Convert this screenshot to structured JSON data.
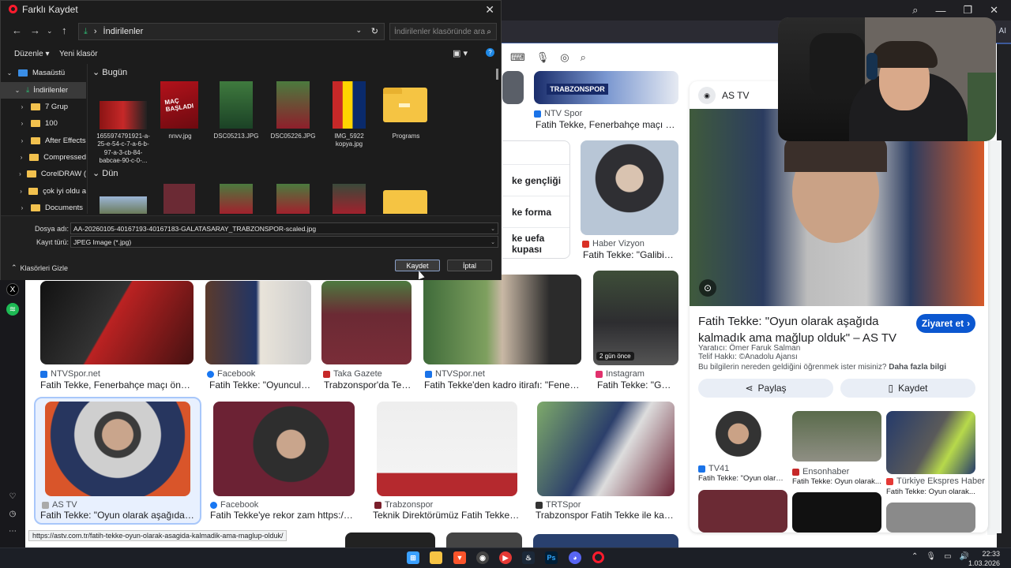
{
  "dialog": {
    "title": "Farklı Kaydet",
    "breadcrumb": "İndirilenler",
    "search_placeholder": "İndirilenler klasöründe ara",
    "commands": {
      "organize": "Düzenle",
      "new_folder": "Yeni klasör"
    },
    "tree": [
      {
        "label": "Masaüstü",
        "expanded": true
      },
      {
        "label": "İndirilenler",
        "selected": true
      },
      {
        "label": "7 Grup"
      },
      {
        "label": "100"
      },
      {
        "label": "After Effects"
      },
      {
        "label": "Compressed"
      },
      {
        "label": "CorelDRAW ("
      },
      {
        "label": "çok iyi oldu a"
      },
      {
        "label": "Documents"
      }
    ],
    "groups": {
      "today": "Bugün",
      "yesterday": "Dün"
    },
    "today_files": [
      {
        "name": "1655974791921-a-25-e-54-c-7-a-6-b-97-a-3-cb-84-babcae-90-c-0-..."
      },
      {
        "name": "nnvv.jpg"
      },
      {
        "name": "DSC05213.JPG"
      },
      {
        "name": "DSC05226.JPG"
      },
      {
        "name": "IMG_5922 kopya.jpg"
      },
      {
        "name": "Programs"
      }
    ],
    "filename_label": "Dosya adı:",
    "filename_value": "AA-20260105-40167193-40167183-GALATASARAY_TRABZONSPOR-scaled.jpg",
    "filetype_label": "Kayıt türü:",
    "filetype_value": "JPEG Image (*.jpg)",
    "hide_folders": "Klasörleri Gizle",
    "save_button": "Kaydet",
    "cancel_button": "İptal"
  },
  "results": {
    "top": [
      {
        "source": "NTV Spor",
        "title": "Fatih Tekke, Fenerbahçe maçı öncesi k..."
      },
      {
        "source": "Haber Vizyon",
        "title": "Fatih Tekke: \"Galibiyeti c..."
      }
    ],
    "related": [
      "ke gençliği",
      "ke forma",
      "ke uefa kupası"
    ],
    "row2": [
      {
        "source": "NTVSpor.net",
        "title": "Fatih Tekke, Fenerbahçe maçı öncesi kötü ..."
      },
      {
        "source": "Facebook",
        "title": "Fatih Tekke: \"Oyuncular..."
      },
      {
        "source": "Taka Gazete",
        "title": "Trabzonspor'da Tekke'..."
      },
      {
        "source": "NTVSpor.net",
        "title": "Fatih Tekke'den kadro itirafı: \"Fenerbahçe v..."
      },
      {
        "source": "Instagram",
        "title": "Fatih Tekke: \"Gal...",
        "badge": "2 gün önce"
      }
    ],
    "row3": [
      {
        "source": "AS TV",
        "title": "Fatih Tekke: \"Oyun olarak aşağıda kalmadı..."
      },
      {
        "source": "Facebook",
        "title": "Fatih Tekke'ye rekor zam https://shorturl...."
      },
      {
        "source": "Trabzonspor",
        "title": "Teknik Direktörümüz Fatih Tekke ve Kapt..."
      },
      {
        "source": "TRTSpor",
        "title": "Trabzonspor Fatih Tekke ile kaybetmiy..."
      }
    ]
  },
  "panel": {
    "source": "AS TV",
    "title": "Fatih Tekke: \"Oyun olarak aşağıda kalmadık ama mağlup olduk\" – AS TV",
    "visit": "Ziyaret et",
    "creator": "Yaratıcı: Ömer Faruk Salman",
    "copyright": "Telif Hakkı: ©Anadolu Ajansı",
    "learn_more_prefix": "Bu bilgilerin nereden geldiğini öğrenmek ister misiniz?",
    "learn_more_link": "Daha fazla bilgi",
    "share": "Paylaş",
    "save": "Kaydet",
    "related": [
      {
        "source": "TV41",
        "title": "Fatih Tekke: \"Oyun olarak..."
      },
      {
        "source": "Ensonhaber",
        "title": "Fatih Tekke: Oyun olarak..."
      },
      {
        "source": "Türkiye Ekspres Haber",
        "title": "Fatih Tekke: Oyun olarak..."
      }
    ]
  },
  "tab_partial_label": "AI",
  "status_url": "https://astv.com.tr/fatih-tekke-oyun-olarak-asagida-kalmadik-ama-maglup-olduk/",
  "clock": {
    "time": "22:33",
    "date": "1.03.2026"
  }
}
